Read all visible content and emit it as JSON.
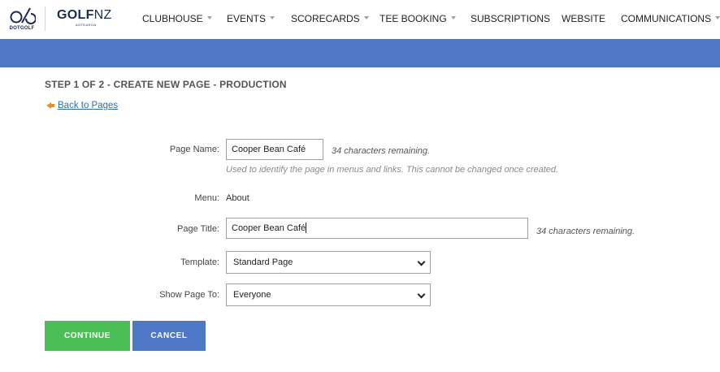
{
  "header": {
    "logo_dotgolf_sub": "DOTGOLF",
    "logo_golfnz_main": "GOLF",
    "logo_golfnz_nz": "NZ",
    "logo_golfnz_sub": "AOTEAROA",
    "nav": [
      {
        "label": "CLUBHOUSE",
        "has_caret": true
      },
      {
        "label": "EVENTS",
        "has_caret": true
      },
      {
        "label": "SCORECARDS",
        "has_caret": true
      },
      {
        "label": "TEE BOOKING",
        "has_caret": true
      },
      {
        "label": "SUBSCRIPTIONS",
        "has_caret": false
      },
      {
        "label": "WEBSITE",
        "has_caret": false
      },
      {
        "label": "COMMUNICATIONS",
        "has_caret": true
      }
    ]
  },
  "page": {
    "step_title": "STEP 1 OF 2 - CREATE NEW PAGE - PRODUCTION",
    "back_link": "Back to Pages"
  },
  "form": {
    "page_name_label": "Page Name:",
    "page_name_value": "Cooper Bean Café",
    "page_name_remaining": "34 characters remaining.",
    "page_name_help": "Used to identify the page in menus and links. This cannot be changed once created.",
    "menu_label": "Menu:",
    "menu_value": "About",
    "page_title_label": "Page Title:",
    "page_title_value": "Cooper Bean Café",
    "page_title_remaining": "34 characters remaining.",
    "template_label": "Template:",
    "template_value": "Standard Page",
    "show_to_label": "Show Page To:",
    "show_to_value": "Everyone"
  },
  "buttons": {
    "continue": "CONTINUE",
    "cancel": "CANCEL"
  },
  "colors": {
    "band": "#4e77c5",
    "continue": "#4bbf55",
    "cancel": "#4e77c5",
    "link": "#2a6eb8",
    "back_arrow": "#e3902a"
  }
}
